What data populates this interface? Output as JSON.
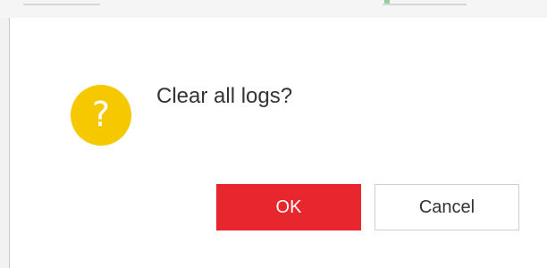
{
  "dialog": {
    "message": "Clear all logs?",
    "icon": "question-icon",
    "icon_glyph": "?",
    "icon_color": "#f6c800",
    "buttons": {
      "ok_label": "OK",
      "cancel_label": "Cancel"
    },
    "colors": {
      "ok_background": "#e7262d",
      "ok_text": "#ffffff",
      "cancel_border": "#cfcfcf"
    }
  }
}
